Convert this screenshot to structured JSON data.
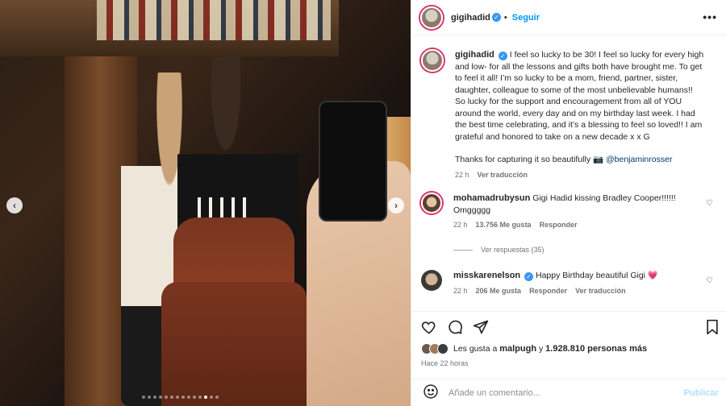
{
  "post": {
    "username": "gigihadid",
    "follow_label": "Seguir",
    "separator": "•",
    "more_label": "•••"
  },
  "caption": {
    "username": "gigihadid",
    "text": "I feel so lucky to be 30! I feel so lucky for every high and low- for all the lessons and gifts both have brought me. To get to feel it all! I’m so lucky to be a mom, friend, partner, sister, daughter, colleague to some of the most unbelievable humans!! So lucky for the support and encouragement from all of YOU around the world, every day and on my birthday last week. I had the best time celebrating, and it’s a blessing to feel so loved!! I am grateful and honored to take on a new decade x x G",
    "thanks": "Thanks for capturing it so beautifully 📷",
    "mention": "@benjaminrosser",
    "time": "22 h",
    "translate": "Ver traducción"
  },
  "comments": [
    {
      "username": "mohamadrubysun",
      "text": "Gigi Hadid kissing Bradley Cooper!!!!!! Omggggg",
      "time": "22 h",
      "likes": "13.756 Me gusta",
      "reply": "Responder",
      "view_replies": "Ver respuestas (35)"
    },
    {
      "username": "misskarenelson",
      "text": "Happy Birthday beautiful Gigi",
      "heart": "💗",
      "time": "22 h",
      "likes": "206 Me gusta",
      "reply": "Responder",
      "translate": "Ver traducción"
    }
  ],
  "likes_summary": {
    "prefix": "Les gusta a",
    "user": "malpugh",
    "middle": "y",
    "count": "1.928.810 personas más"
  },
  "timestamp": "Hace 22 horas",
  "comment_box": {
    "placeholder": "Añade un comentario...",
    "publish_label": "Publicar"
  },
  "carousel": {
    "total": 14,
    "active_index": 11,
    "prev_label": "‹",
    "next_label": "›"
  },
  "colors": {
    "accent": "#0095f6",
    "verified": "#3897f0",
    "muted": "#737373",
    "text": "#262626"
  },
  "icons": [
    "heart-icon",
    "comment-icon",
    "share-icon",
    "bookmark-icon",
    "emoji-icon",
    "verified-icon",
    "more-icon"
  ]
}
